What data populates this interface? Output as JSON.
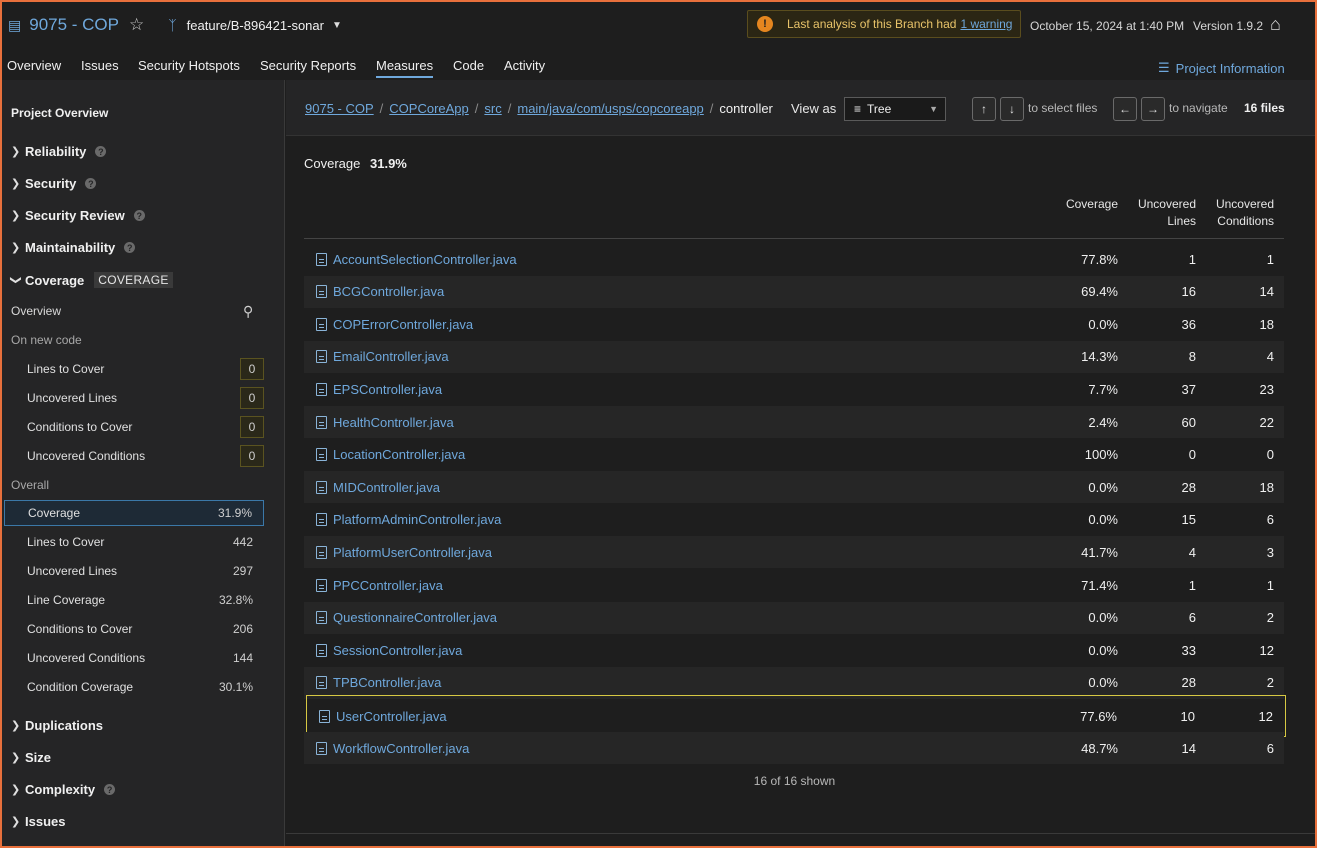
{
  "header": {
    "project_name": "9075 - COP",
    "branch": "feature/B-896421-sonar",
    "warning_text": "Last analysis of this Branch had",
    "warning_link": "1 warning",
    "date": "October 15, 2024 at 1:40 PM",
    "version": "Version 1.9.2"
  },
  "nav": {
    "tabs": [
      "Overview",
      "Issues",
      "Security Hotspots",
      "Security Reports",
      "Measures",
      "Code",
      "Activity"
    ],
    "active": "Measures",
    "project_info": "Project Information"
  },
  "sidebar": {
    "title": "Project Overview",
    "sections": {
      "reliability": "Reliability",
      "security": "Security",
      "security_review": "Security Review",
      "maintainability": "Maintainability",
      "coverage": "Coverage",
      "coverage_tag": "COVERAGE",
      "duplications": "Duplications",
      "size": "Size",
      "complexity": "Complexity",
      "issues": "Issues"
    },
    "overview_label": "Overview",
    "new_code_label": "On new code",
    "overall_label": "Overall",
    "new_code": [
      {
        "label": "Lines to Cover",
        "value": "0"
      },
      {
        "label": "Uncovered Lines",
        "value": "0"
      },
      {
        "label": "Conditions to Cover",
        "value": "0"
      },
      {
        "label": "Uncovered Conditions",
        "value": "0"
      }
    ],
    "overall": [
      {
        "label": "Coverage",
        "value": "31.9%"
      },
      {
        "label": "Lines to Cover",
        "value": "442"
      },
      {
        "label": "Uncovered Lines",
        "value": "297"
      },
      {
        "label": "Line Coverage",
        "value": "32.8%"
      },
      {
        "label": "Conditions to Cover",
        "value": "206"
      },
      {
        "label": "Uncovered Conditions",
        "value": "144"
      },
      {
        "label": "Condition Coverage",
        "value": "30.1%"
      }
    ]
  },
  "breadcrumb": {
    "parts": [
      "9075 - COP",
      "COPCoreApp",
      "src",
      "main/java/com/usps/copcoreapp"
    ],
    "current": "controller"
  },
  "toolbar": {
    "view_as": "View as",
    "view_mode": "Tree",
    "select_hint": "to select files",
    "navigate_hint": "to navigate",
    "files_count": "16 files",
    "up_key": "↑",
    "down_key": "↓",
    "left_key": "←",
    "right_key": "→"
  },
  "summary": {
    "label": "Coverage",
    "value": "31.9%"
  },
  "table": {
    "col_coverage": "Coverage",
    "col_uncovered_lines_1": "Uncovered",
    "col_uncovered_lines_2": "Lines",
    "col_uncovered_conditions_1": "Uncovered",
    "col_uncovered_conditions_2": "Conditions",
    "rows": [
      {
        "file": "AccountSelectionController.java",
        "coverage": "77.8%",
        "lines": "1",
        "conditions": "1"
      },
      {
        "file": "BCGController.java",
        "coverage": "69.4%",
        "lines": "16",
        "conditions": "14"
      },
      {
        "file": "COPErrorController.java",
        "coverage": "0.0%",
        "lines": "36",
        "conditions": "18"
      },
      {
        "file": "EmailController.java",
        "coverage": "14.3%",
        "lines": "8",
        "conditions": "4"
      },
      {
        "file": "EPSController.java",
        "coverage": "7.7%",
        "lines": "37",
        "conditions": "23"
      },
      {
        "file": "HealthController.java",
        "coverage": "2.4%",
        "lines": "60",
        "conditions": "22"
      },
      {
        "file": "LocationController.java",
        "coverage": "100%",
        "lines": "0",
        "conditions": "0"
      },
      {
        "file": "MIDController.java",
        "coverage": "0.0%",
        "lines": "28",
        "conditions": "18"
      },
      {
        "file": "PlatformAdminController.java",
        "coverage": "0.0%",
        "lines": "15",
        "conditions": "6"
      },
      {
        "file": "PlatformUserController.java",
        "coverage": "41.7%",
        "lines": "4",
        "conditions": "3"
      },
      {
        "file": "PPCController.java",
        "coverage": "71.4%",
        "lines": "1",
        "conditions": "1"
      },
      {
        "file": "QuestionnaireController.java",
        "coverage": "0.0%",
        "lines": "6",
        "conditions": "2"
      },
      {
        "file": "SessionController.java",
        "coverage": "0.0%",
        "lines": "33",
        "conditions": "12"
      },
      {
        "file": "TPBController.java",
        "coverage": "0.0%",
        "lines": "28",
        "conditions": "2"
      },
      {
        "file": "UserController.java",
        "coverage": "77.6%",
        "lines": "10",
        "conditions": "12"
      },
      {
        "file": "WorkflowController.java",
        "coverage": "48.7%",
        "lines": "14",
        "conditions": "6"
      }
    ],
    "shown": "16 of 16 shown"
  },
  "colors": {
    "accent": "#6fa8dc",
    "warning": "#e5861f",
    "highlight": "#d6c843",
    "border": "#e8703c"
  }
}
